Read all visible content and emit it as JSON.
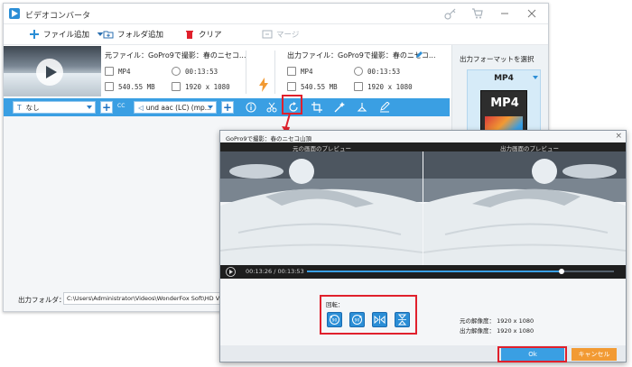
{
  "app": {
    "title": "ビデオコンバータ"
  },
  "toolbar": {
    "add_file": "ファイル追加",
    "add_folder": "フォルダ追加",
    "clear": "クリア",
    "merge": "マージ"
  },
  "source": {
    "label": "元ファイル：GoPro9で撮影：春のニセコ...",
    "format": "MP4",
    "duration": "00:13:53",
    "size": "540.55 MB",
    "resolution": "1920 x 1080"
  },
  "output": {
    "label": "出力ファイル：GoPro9で撮影：春のニセコ...",
    "format": "MP4",
    "duration": "00:13:53",
    "size": "540.55 MB",
    "resolution": "1920 x 1080"
  },
  "options": {
    "subtitle_value": "なし",
    "cc_label": "CC",
    "audio_value": "und aac (LC) (mp..."
  },
  "right_panel": {
    "select_format_label": "出力フォーマットを選択",
    "format_name": "MP4",
    "format_badge": "MP4"
  },
  "output_folder": {
    "label": "出力フォルダ：",
    "path": "C:\\Users\\Administrator\\Videos\\WonderFox Soft\\HD Video Converte"
  },
  "dialog": {
    "title": "GoPro9で撮影：春のニセコ山頂",
    "close": "×",
    "original_preview": "元の画面のプレビュー",
    "output_preview": "出力画面のプレビュー",
    "time": "00:13:26 / 00:13:53",
    "progress": 0.83,
    "rotate_label": "回転：",
    "original_resolution": "元の解像度： 1920 x 1080",
    "output_resolution": "出力解像度： 1920 x 1080",
    "ok": "Ok",
    "cancel": "キャンセル"
  },
  "colors": {
    "accent": "#3a9fe3",
    "highlight": "#e0202c",
    "cancel": "#f29a33",
    "orange": "#f29a33"
  }
}
